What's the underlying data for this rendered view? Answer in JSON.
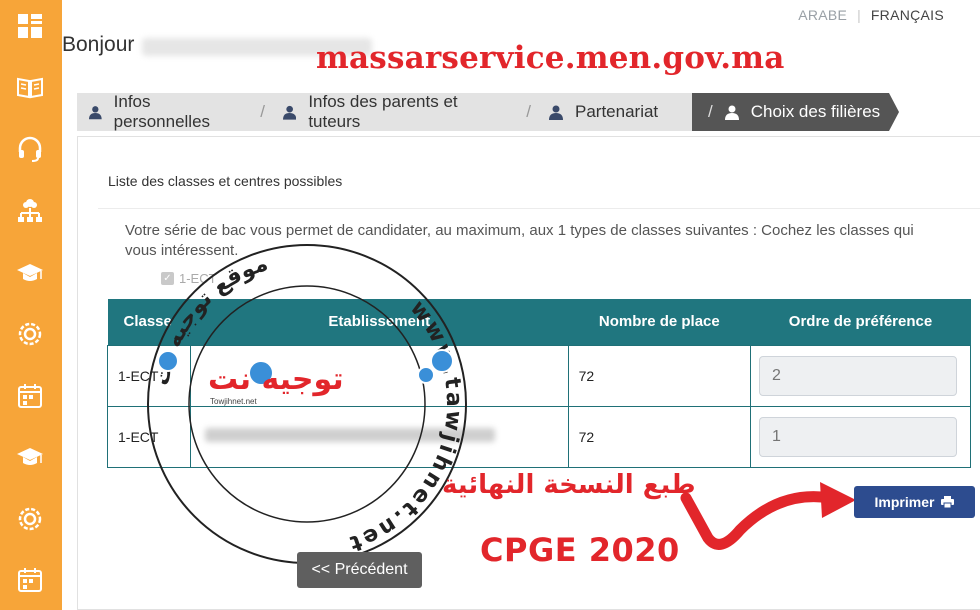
{
  "header": {
    "lang_arabe": "ARABE",
    "lang_separator": "|",
    "lang_francais": "FRANÇAIS",
    "greeting": "Bonjour",
    "site_url": "massarservice.men.gov.ma"
  },
  "sidebar": {
    "icons": [
      "grid-icon",
      "book-icon",
      "headset-icon",
      "network-icon",
      "graduation-cap-icon",
      "gear-icon",
      "calendar-icon",
      "graduation-cap-icon",
      "gear-icon",
      "calendar-icon"
    ]
  },
  "tabs": [
    {
      "label": "Infos personnelles",
      "active": false
    },
    {
      "label": "Infos des parents et tuteurs",
      "active": false
    },
    {
      "label": "Partenariat",
      "active": false
    },
    {
      "label": "Choix des filières",
      "active": true
    }
  ],
  "tab_separator": "/",
  "panel": {
    "title": "Liste des classes et centres possibles",
    "instructions": "Votre série de bac vous permet de candidater, au maximum, aux 1 types de classes suivantes : Cochez les classes qui vous intéressent.",
    "checkbox_label": "1-ECT",
    "checkbox_checked": true
  },
  "table": {
    "columns": [
      "Classe",
      "Etablissement",
      "Nombre de place",
      "Ordre de préférence"
    ],
    "rows": [
      {
        "classe": "1-ECT",
        "places": "72",
        "ordre_placeholder": "2"
      },
      {
        "classe": "1-ECT",
        "places": "72",
        "ordre_placeholder": "1"
      }
    ]
  },
  "buttons": {
    "print_label": "Imprimer",
    "prev_label": "<< Précédent"
  },
  "annotations": {
    "arabic_caption": "طبع النسخة النهائية",
    "cpge": "CPGE 2020",
    "watermark_logo": "توجيه نت",
    "watermark_logo_sub": "Towjihnet.net",
    "watermark_ring": "www.tawjihnet.net",
    "watermark_arabic_ring": "موقع توجيه نت"
  },
  "colors": {
    "sidebar": "#f7a539",
    "table_header": "#20767f",
    "active_tab": "#555555",
    "print_button": "#2d4c8f",
    "annotation_red": "#e2262b"
  }
}
